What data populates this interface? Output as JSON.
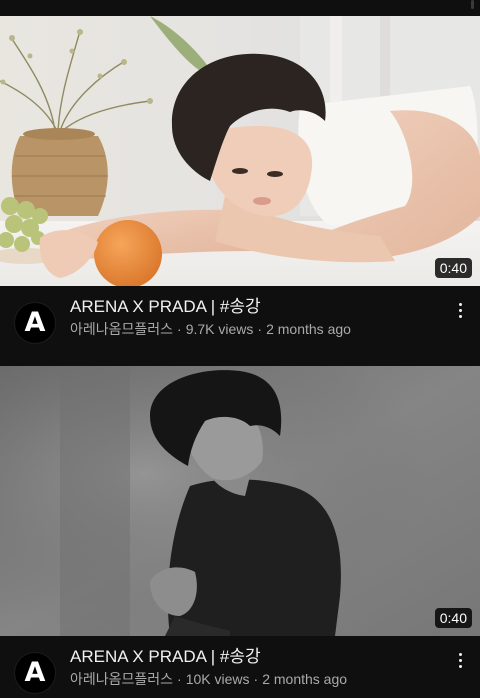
{
  "feed": {
    "videos": [
      {
        "title": "ARENA X PRADA | #송강",
        "channel": "아레나옴므플러스",
        "views": "9.7K views",
        "age": "2 months ago",
        "duration": "0:40",
        "avatar_letter": "A",
        "separator": "·"
      },
      {
        "title": "ARENA X PRADA | #송강",
        "channel": "아레나옴므플러스",
        "views": "10K views",
        "age": "2 months ago",
        "duration": "0:40",
        "avatar_letter": "A",
        "separator": "·"
      }
    ]
  },
  "colors": {
    "background": "#0f0f0f",
    "text_primary": "#f1f1f1",
    "text_secondary": "#aaaaaa"
  },
  "icons": {
    "menu": "more-vert-icon",
    "avatar": "channel-avatar-icon"
  }
}
